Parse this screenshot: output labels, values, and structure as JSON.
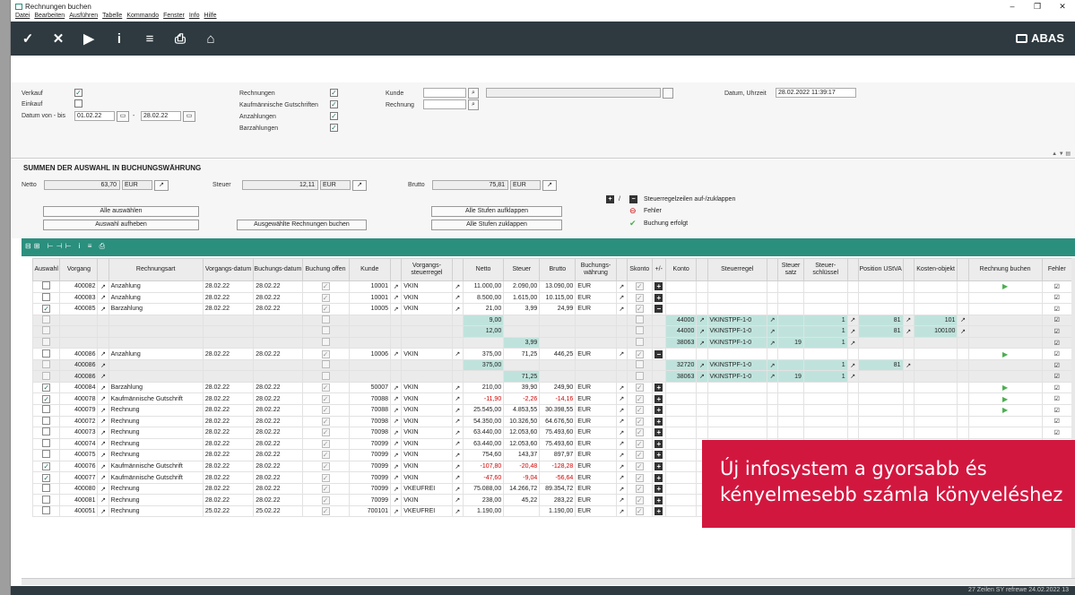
{
  "window": {
    "title": "Rechnungen buchen",
    "controls": [
      "–",
      "❐",
      "✕"
    ]
  },
  "menu": [
    "Datei",
    "Bearbeiten",
    "Ausführen",
    "Tabelle",
    "Kommando",
    "Fenster",
    "Info",
    "Hilfe"
  ],
  "toolbar": {
    "icons": [
      "check-icon",
      "close-icon",
      "play-icon",
      "info-icon",
      "list-icon",
      "print-icon",
      "home-icon"
    ],
    "glyphs": [
      "✓",
      "✕",
      "▶",
      "i",
      "≡",
      "⎙",
      "⌂"
    ],
    "brand": "ABAS"
  },
  "filter": {
    "verkauf": "Verkauf",
    "einkauf": "Einkauf",
    "datum_von_bis": "Datum von - bis",
    "datum_von": "01.02.22",
    "datum_bis": "28.02.22",
    "dash": "-",
    "rechnungen": "Rechnungen",
    "gutschriften": "Kaufmännische Gutschriften",
    "anzahlungen": "Anzahlungen",
    "barzahlungen": "Barzahlungen",
    "kunde": "Kunde",
    "rechnung": "Rechnung",
    "datum_uhrzeit": "Datum, Uhrzeit",
    "datum_uhrzeit_value": "28.02.2022 11:39:17"
  },
  "summary": {
    "title": "SUMMEN DER AUSWAHL IN BUCHUNGSWÄHRUNG",
    "netto_label": "Netto",
    "netto": "63,70",
    "steuer_label": "Steuer",
    "steuer": "12,11",
    "brutto_label": "Brutto",
    "brutto": "75,81",
    "currency": "EUR",
    "buttons": {
      "alle_auswaehlen": "Alle auswählen",
      "auswahl_aufheben": "Auswahl aufheben",
      "buchen": "Ausgewählte Rechnungen buchen",
      "aufklappen": "Alle Stufen aufklappen",
      "zuklappen": "Alle Stufen zuklappen"
    },
    "legend": {
      "slash": "/",
      "steuerregel": "Steuerregelzeilen auf-/zuklappen",
      "fehler": "Fehler",
      "erfolgt": "Buchung erfolgt"
    }
  },
  "grid": {
    "headers": [
      "Auswahl",
      "Vorgang",
      "",
      "Rechnungsart",
      "Vorgangs-datum",
      "Buchungs-datum",
      "Buchung offen",
      "Kunde",
      "",
      "Vorgangs-steuerregel",
      "",
      "Netto",
      "Steuer",
      "Brutto",
      "Buchungs-währung",
      "",
      "Skonto",
      "+/-",
      "Konto",
      "",
      "Steuerregel",
      "",
      "Steuer satz",
      "Steuer-schlüssel",
      "",
      "Position UStVA",
      "",
      "Kosten-objekt",
      "",
      "Rechnung buchen",
      "Fehler"
    ],
    "rows": [
      {
        "sel": "0",
        "v": "400082",
        "art": "Anzahlung",
        "vd": "28.02.22",
        "bd": "28.02.22",
        "k": "10001",
        "sr": "VKIN",
        "n": "11.000,00",
        "s": "2.090,00",
        "b": "13.090,00",
        "w": "EUR",
        "pm": "+",
        "act": "▶"
      },
      {
        "sel": "0",
        "v": "400083",
        "art": "Anzahlung",
        "vd": "28.02.22",
        "bd": "28.02.22",
        "k": "10001",
        "sr": "VKIN",
        "n": "8.500,00",
        "s": "1.615,00",
        "b": "10.115,00",
        "w": "EUR",
        "pm": "+",
        "act": ""
      },
      {
        "sel": "1",
        "v": "400085",
        "art": "Barzahlung",
        "vd": "28.02.22",
        "bd": "28.02.22",
        "k": "10005",
        "sr": "VKIN",
        "n": "21,00",
        "s": "3,99",
        "b": "24,99",
        "w": "EUR",
        "pm": "−",
        "act": ""
      },
      {
        "sub": true,
        "n": "9,00",
        "konto": "44000",
        "regel": "VKINSTPF-1-0",
        "schl": "1",
        "pos": "81",
        "ko": "101"
      },
      {
        "sub": true,
        "n": "12,00",
        "konto": "44000",
        "regel": "VKINSTPF-1-0",
        "schl": "1",
        "pos": "81",
        "ko": "100100"
      },
      {
        "sub": true,
        "s": "3,99",
        "konto": "38063",
        "regel": "VKINSTPF-1-0",
        "satz": "19",
        "schl": "1"
      },
      {
        "sel": "0",
        "v": "400086",
        "art": "Anzahlung",
        "vd": "28.02.22",
        "bd": "28.02.22",
        "k": "10006",
        "sr": "VKIN",
        "n": "375,00",
        "s": "71,25",
        "b": "446,25",
        "w": "EUR",
        "pm": "−",
        "act": "▶"
      },
      {
        "sub": true,
        "v": "400086",
        "n": "375,00",
        "konto": "32720",
        "regel": "VKINSTPF-1-0",
        "schl": "1",
        "pos": "81"
      },
      {
        "sub": true,
        "v": "400086",
        "s": "71,25",
        "konto": "38063",
        "regel": "VKINSTPF-1-0",
        "satz": "19",
        "schl": "1"
      },
      {
        "sel": "1",
        "v": "400084",
        "art": "Barzahlung",
        "vd": "28.02.22",
        "bd": "28.02.22",
        "k": "50007",
        "sr": "VKIN",
        "n": "210,00",
        "s": "39,90",
        "b": "249,90",
        "w": "EUR",
        "pm": "+",
        "act": "▶"
      },
      {
        "sel": "1",
        "v": "400078",
        "art": "Kaufmännische Gutschrift",
        "vd": "28.02.22",
        "bd": "28.02.22",
        "k": "70088",
        "sr": "VKIN",
        "n": "-11,90",
        "s": "-2,26",
        "b": "-14,16",
        "w": "EUR",
        "pm": "+",
        "act": "▶",
        "neg": true
      },
      {
        "sel": "0",
        "v": "400079",
        "art": "Rechnung",
        "vd": "28.02.22",
        "bd": "28.02.22",
        "k": "70088",
        "sr": "VKIN",
        "n": "25.545,00",
        "s": "4.853,55",
        "b": "30.398,55",
        "w": "EUR",
        "pm": "+",
        "act": "▶"
      },
      {
        "sel": "0",
        "v": "400072",
        "art": "Rechnung",
        "vd": "28.02.22",
        "bd": "28.02.22",
        "k": "70098",
        "sr": "VKIN",
        "n": "54.350,00",
        "s": "10.326,50",
        "b": "64.676,50",
        "w": "EUR",
        "pm": "+",
        "act": ""
      },
      {
        "sel": "0",
        "v": "400073",
        "art": "Rechnung",
        "vd": "28.02.22",
        "bd": "28.02.22",
        "k": "70098",
        "sr": "VKIN",
        "n": "63.440,00",
        "s": "12.053,60",
        "b": "75.493,60",
        "w": "EUR",
        "pm": "+",
        "act": ""
      },
      {
        "sel": "0",
        "v": "400074",
        "art": "Rechnung",
        "vd": "28.02.22",
        "bd": "28.02.22",
        "k": "70099",
        "sr": "VKIN",
        "n": "63.440,00",
        "s": "12.053,60",
        "b": "75.493,60",
        "w": "EUR",
        "pm": "+",
        "act": ""
      },
      {
        "sel": "0",
        "v": "400075",
        "art": "Rechnung",
        "vd": "28.02.22",
        "bd": "28.02.22",
        "k": "70099",
        "sr": "VKIN",
        "n": "754,60",
        "s": "143,37",
        "b": "897,97",
        "w": "EUR",
        "pm": "+",
        "act": ""
      },
      {
        "sel": "1",
        "v": "400076",
        "art": "Kaufmännische Gutschrift",
        "vd": "28.02.22",
        "bd": "28.02.22",
        "k": "70099",
        "sr": "VKIN",
        "n": "-107,80",
        "s": "-20,48",
        "b": "-128,28",
        "w": "EUR",
        "pm": "+",
        "act": "",
        "neg": true
      },
      {
        "sel": "1",
        "v": "400077",
        "art": "Kaufmännische Gutschrift",
        "vd": "28.02.22",
        "bd": "28.02.22",
        "k": "70099",
        "sr": "VKIN",
        "n": "-47,60",
        "s": "-9,04",
        "b": "-56,64",
        "w": "EUR",
        "pm": "+",
        "act": "",
        "neg": true
      },
      {
        "sel": "0",
        "v": "400080",
        "art": "Rechnung",
        "vd": "28.02.22",
        "bd": "28.02.22",
        "k": "70099",
        "sr": "VKEUFREI",
        "n": "75.088,00",
        "s": "14.266,72",
        "b": "89.354,72",
        "w": "EUR",
        "pm": "+",
        "act": ""
      },
      {
        "sel": "0",
        "v": "400081",
        "art": "Rechnung",
        "vd": "28.02.22",
        "bd": "28.02.22",
        "k": "70099",
        "sr": "VKIN",
        "n": "238,00",
        "s": "45,22",
        "b": "283,22",
        "w": "EUR",
        "pm": "+",
        "act": "▶"
      },
      {
        "sel": "0",
        "v": "400051",
        "art": "Rechnung",
        "vd": "25.02.22",
        "bd": "25.02.22",
        "k": "700101",
        "sr": "VKEUFREI",
        "n": "1.190,00",
        "s": "",
        "b": "1.190,00",
        "w": "EUR",
        "pm": "+",
        "act": "▶"
      }
    ]
  },
  "status": "27 Zeilen   SY   refrewe 24.02.2022   13",
  "banner": {
    "line1": "Új infosystem a gyorsabb és",
    "line2": "kényelmesebb számla könyveléshez"
  }
}
